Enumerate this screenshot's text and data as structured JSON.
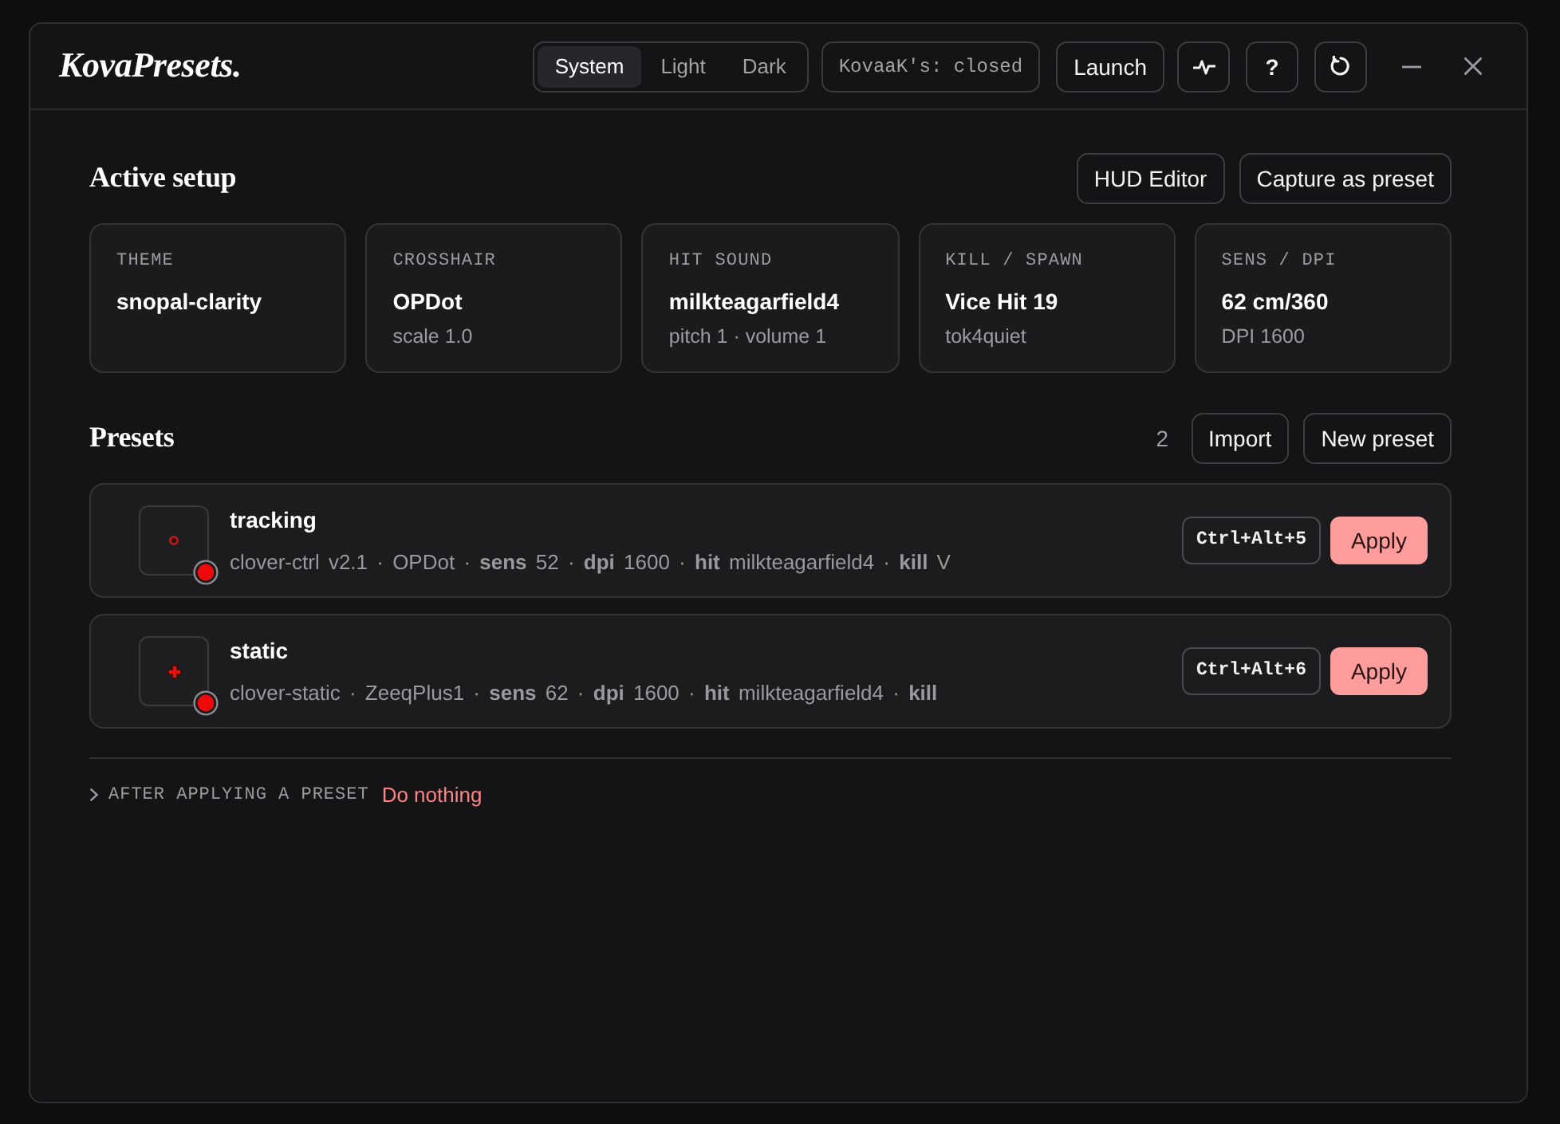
{
  "header": {
    "logo": "KovaPresets.",
    "theme_options": [
      {
        "label": "System",
        "selected": true
      },
      {
        "label": "Light",
        "selected": false
      },
      {
        "label": "Dark",
        "selected": false
      }
    ],
    "game_status": "KovaaK's: closed",
    "launch_button": "Launch",
    "help_button": "?"
  },
  "active_setup": {
    "title": "Active setup",
    "buttons": [
      "HUD Editor",
      "Capture as preset"
    ],
    "cards": [
      {
        "label": "THEME",
        "value": "snopal-clarity"
      },
      {
        "label": "CROSSHAIR",
        "value": "OPDot",
        "detail": "scale 1.0"
      },
      {
        "label": "HIT SOUND",
        "value": "milkteagarfield4",
        "detail": "pitch 1 · volume 1"
      },
      {
        "label": "KILL / SPAWN",
        "value": "Vice Hit 19",
        "detail": "tok4quiet"
      },
      {
        "label": "SENS / DPI",
        "value": "62 cm/360",
        "detail": "DPI 1600"
      }
    ]
  },
  "presets": {
    "title": "Presets",
    "count": "2",
    "buttons": [
      "Import",
      "New preset"
    ],
    "items": [
      {
        "name": "tracking",
        "thumbnail": {
          "kind": "dot"
        },
        "details": "clover-ctrl v2.1 · OPDot · **sens** 52 · **dpi** 1600 · **hit** milkteagarfield4 · **kill** V",
        "shortcut": "Ctrl+Alt+5",
        "apply_button": "Apply"
      },
      {
        "name": "static",
        "thumbnail": {
          "kind": "cross"
        },
        "details": "clover-static · ZeeqPlus1 · **sens** 62 · **dpi** 1600 · **hit** milkteagarfield4 · **kill**",
        "shortcut": "Ctrl+Alt+6",
        "apply_button": "Apply"
      }
    ]
  },
  "after_apply": {
    "label": "AFTER APPLYING A PRESET",
    "value": "Do nothing",
    "expanded": false
  }
}
